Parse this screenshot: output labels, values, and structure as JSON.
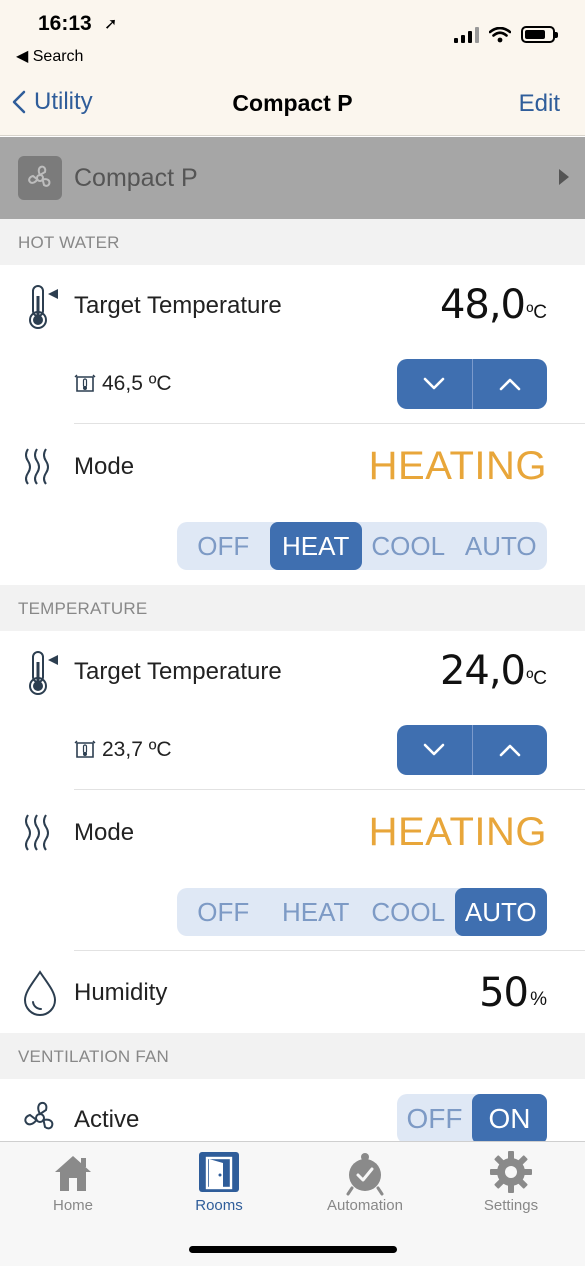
{
  "status": {
    "time": "16:13",
    "back_app": "Search"
  },
  "nav": {
    "back_label": "Utility",
    "title": "Compact P",
    "edit_label": "Edit"
  },
  "device": {
    "name": "Compact P",
    "icon": "fan-icon"
  },
  "sections": {
    "hot_water": {
      "header": "HOT WATER",
      "target_label": "Target Temperature",
      "target_value": "48,0",
      "target_unit": "ºC",
      "current_value": "46,5 ºC",
      "mode_label": "Mode",
      "mode_value": "HEATING",
      "mode_options": [
        "OFF",
        "HEAT",
        "COOL",
        "AUTO"
      ],
      "mode_selected": "HEAT"
    },
    "temperature": {
      "header": "TEMPERATURE",
      "target_label": "Target Temperature",
      "target_value": "24,0",
      "target_unit": "ºC",
      "current_value": "23,7 ºC",
      "mode_label": "Mode",
      "mode_value": "HEATING",
      "mode_options": [
        "OFF",
        "HEAT",
        "COOL",
        "AUTO"
      ],
      "mode_selected": "AUTO",
      "humidity_label": "Humidity",
      "humidity_value": "50",
      "humidity_unit": "%"
    },
    "ventilation": {
      "header": "VENTILATION FAN",
      "active_label": "Active",
      "options": [
        "OFF",
        "ON"
      ],
      "selected": "ON"
    }
  },
  "tabs": [
    {
      "label": "Home",
      "icon": "home-icon"
    },
    {
      "label": "Rooms",
      "icon": "door-icon",
      "active": true
    },
    {
      "label": "Automation",
      "icon": "alarm-clock-icon"
    },
    {
      "label": "Settings",
      "icon": "gear-icon"
    }
  ],
  "colors": {
    "accent": "#3f6fb0",
    "mode_value": "#e8a63a",
    "segment_bg": "#dfe8f5",
    "nav_tint": "#2f5d9a"
  }
}
